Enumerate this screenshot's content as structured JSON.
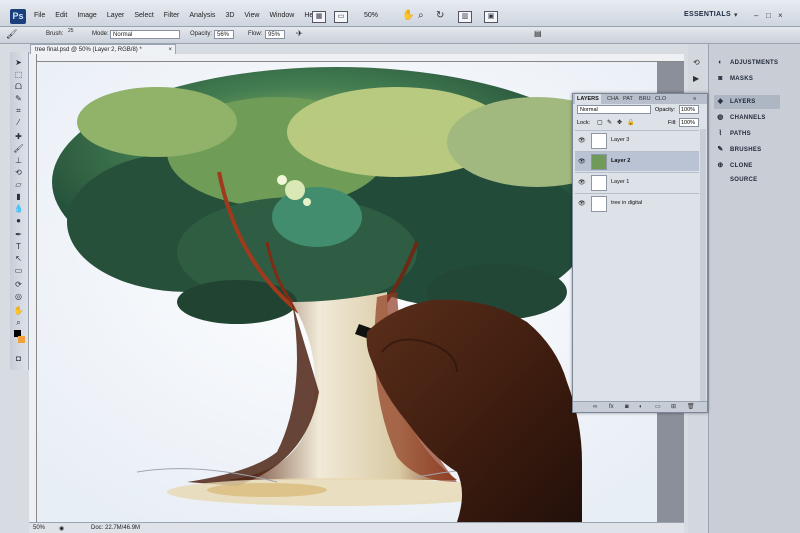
{
  "app": {
    "logo": "Ps",
    "menu": [
      "File",
      "Edit",
      "Image",
      "Layer",
      "Select",
      "Filter",
      "Analysis",
      "3D",
      "View",
      "Window",
      "Help"
    ],
    "zoom": "50%",
    "workspace": "ESSENTIALS",
    "window_buttons": [
      "–",
      "□",
      "×"
    ]
  },
  "options": {
    "brush_label": "Brush:",
    "brush_size": "25",
    "mode_label": "Mode:",
    "mode_value": "Normal",
    "opacity_label": "Opacity:",
    "opacity_value": "56%",
    "flow_label": "Flow:",
    "flow_value": "95%"
  },
  "document": {
    "tab_title": "tree final.psd @ 50% (Layer 2, RGB/8) *",
    "status_zoom": "50%",
    "status_doc": "Doc: 22.7M/46.9M"
  },
  "dock": {
    "items": [
      {
        "label": "ADJUSTMENTS",
        "icon": "adjustments-icon"
      },
      {
        "label": "MASKS",
        "icon": "masks-icon"
      },
      {
        "label": "LAYERS",
        "icon": "layers-icon",
        "active": true
      },
      {
        "label": "CHANNELS",
        "icon": "channels-icon"
      },
      {
        "label": "PATHS",
        "icon": "paths-icon"
      },
      {
        "label": "BRUSHES",
        "icon": "brushes-icon"
      },
      {
        "label": "CLONE SOURCE",
        "icon": "clone-source-icon"
      }
    ]
  },
  "layers_panel": {
    "tabs": [
      "LAYERS",
      "CHA",
      "PAT",
      "BRU",
      "CLO"
    ],
    "blend_mode": "Normal",
    "opacity_label": "Opacity:",
    "opacity_value": "100%",
    "lock_label": "Lock:",
    "fill_label": "Fill:",
    "fill_value": "100%",
    "layers": [
      {
        "name": "Layer 3",
        "selected": false
      },
      {
        "name": "Layer 2",
        "selected": true
      },
      {
        "name": "Layer 1",
        "selected": false
      },
      {
        "name": "tree in digital",
        "selected": false
      }
    ],
    "footer_icons": [
      "link-icon",
      "fx-icon",
      "mask-icon",
      "adjustment-layer-icon",
      "group-icon",
      "new-layer-icon",
      "trash-icon"
    ]
  },
  "colors": {
    "foreground": "#000000",
    "background": "#f2a23a",
    "selection": "#b9c3d3"
  }
}
